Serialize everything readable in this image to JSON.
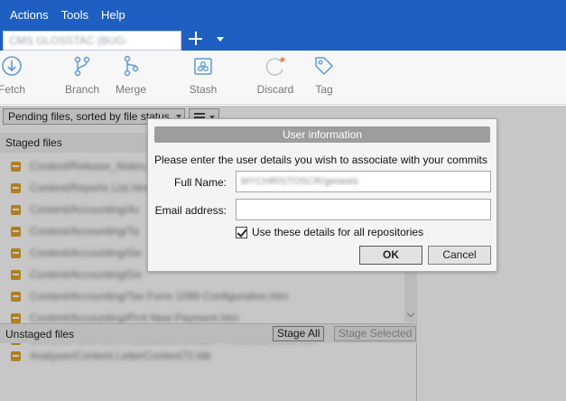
{
  "menu": {
    "items": [
      "Actions",
      "Tools",
      "Help"
    ]
  },
  "tabs": {
    "active_label": "CMS GLOSSTAC (BUG-",
    "add_icon": "plus-icon",
    "dropdown_icon": "caret-down-icon"
  },
  "toolbar": {
    "tools": [
      {
        "label": "Fetch",
        "icon": "fetch-icon"
      },
      {
        "label": "Branch",
        "icon": "branch-icon"
      },
      {
        "label": "Merge",
        "icon": "merge-icon"
      },
      {
        "label": "Stash",
        "icon": "stash-icon"
      },
      {
        "label": "Discard",
        "icon": "discard-icon"
      },
      {
        "label": "Tag",
        "icon": "tag-icon"
      }
    ]
  },
  "filter": {
    "selected": "Pending files, sorted by file status"
  },
  "staged": {
    "header": "Staged files",
    "files": [
      "Content/Release_Notes.htm",
      "Content/Reports List.htm",
      "Content/Accounting/Ac",
      "Content/Accounting/Ta",
      "Content/Accounting/Ge",
      "Content/Accounting/Ge",
      "Content/Accounting/Tax Form 1099 Configuration.htm",
      "Content/Accounting/Prnt New Payment.htm",
      "Content/Fund Stmt Transaction Details – Miscellaneous.htm"
    ]
  },
  "unstaged": {
    "header": "Unstaged files",
    "stage_all": "Stage All",
    "stage_selected": "Stage Selected",
    "files": [
      "Analyser/Content.LetterContent72.ldb"
    ]
  },
  "dialog": {
    "title": "User information",
    "prompt": "Please enter the user details you wish to associate with your commits",
    "full_name_label": "Full Name:",
    "full_name_value": "MYCHRISTOSCR/genesis",
    "email_label": "Email address:",
    "email_value": "",
    "checkbox_label": "Use these details for all repositories",
    "checkbox_checked": true,
    "ok_label": "OK",
    "cancel_label": "Cancel"
  },
  "colors": {
    "brand": "#1e5fc1",
    "file_status": "#e2a52a",
    "dialog_title": "#9d9d9d"
  }
}
